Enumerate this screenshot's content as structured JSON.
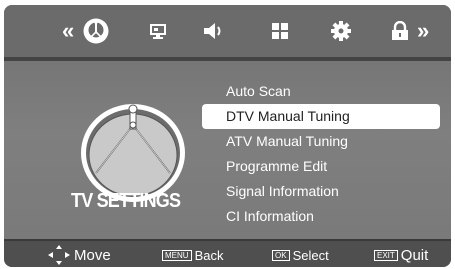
{
  "top_bar": {
    "tabs": [
      {
        "icon": "satellite-dish-icon",
        "selected": true
      },
      {
        "icon": "picture-icon",
        "selected": false
      },
      {
        "icon": "speaker-icon",
        "selected": false
      },
      {
        "icon": "grid-icon",
        "selected": false
      },
      {
        "icon": "gear-icon",
        "selected": false
      },
      {
        "icon": "lock-icon",
        "selected": false
      }
    ],
    "left_arrow": "«",
    "right_arrow": "»"
  },
  "page": {
    "title": "TV SETTINGS",
    "icon": "satellite-dish-icon"
  },
  "menu": {
    "items": [
      {
        "label": "Auto Scan",
        "selected": false
      },
      {
        "label": "DTV Manual Tuning",
        "selected": true
      },
      {
        "label": "ATV Manual Tuning",
        "selected": false
      },
      {
        "label": "Programme Edit",
        "selected": false
      },
      {
        "label": "Signal Information",
        "selected": false
      },
      {
        "label": "CI Information",
        "selected": false
      }
    ]
  },
  "footer": {
    "move_label": "Move",
    "back_key": "MENU",
    "back_label": "Back",
    "select_key": "OK",
    "select_label": "Select",
    "quit_key": "EXIT",
    "quit_label": "Quit"
  },
  "colors": {
    "highlight": "#ffffff",
    "background": "#7a7a7a",
    "footer": "#4f4f4f"
  }
}
